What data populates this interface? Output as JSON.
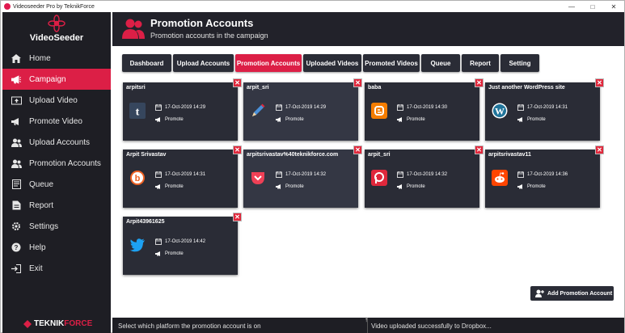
{
  "window": {
    "title": "Videoseeder Pro by TeknikForce",
    "minimize": "—",
    "maximize": "□",
    "close": "✕"
  },
  "sidebar": {
    "logo_text": "VideoSeeder",
    "items": [
      {
        "label": "Home",
        "icon": "home-icon"
      },
      {
        "label": "Campaign",
        "icon": "megaphone-icon"
      },
      {
        "label": "Upload Video",
        "icon": "upload-video-icon"
      },
      {
        "label": "Promote Video",
        "icon": "megaphone-icon"
      },
      {
        "label": "Upload Accounts",
        "icon": "users-icon"
      },
      {
        "label": "Promotion Accounts",
        "icon": "users-icon"
      },
      {
        "label": "Queue",
        "icon": "queue-icon"
      },
      {
        "label": "Report",
        "icon": "report-icon"
      },
      {
        "label": "Settings",
        "icon": "gear-icon"
      },
      {
        "label": "Help",
        "icon": "help-icon"
      },
      {
        "label": "Exit",
        "icon": "exit-icon"
      }
    ],
    "active_index": 1,
    "brand_part1": "TEKNIK",
    "brand_part2": "FORCE"
  },
  "header": {
    "title": "Promotion Accounts",
    "subtitle": "Promotion accounts in the campaign"
  },
  "tabs": [
    {
      "label": "Dashboard"
    },
    {
      "label": "Upload Accounts"
    },
    {
      "label": "Promotion Accounts"
    },
    {
      "label": "Uploaded Videos"
    },
    {
      "label": "Promoted Videos"
    },
    {
      "label": "Queue"
    },
    {
      "label": "Report"
    },
    {
      "label": "Setting"
    }
  ],
  "active_tab": 2,
  "cards": [
    {
      "name": "arpitsri",
      "platform": "tumblr-icon",
      "date": "17-Oct-2019 14:29",
      "status": "Promote"
    },
    {
      "name": "arpit_sri",
      "platform": "pen-icon",
      "date": "17-Oct-2019 14:29",
      "status": "Promote"
    },
    {
      "name": "baba",
      "platform": "blogger-icon",
      "date": "17-Oct-2019 14:30",
      "status": "Promote"
    },
    {
      "name": "Just another WordPress site",
      "platform": "wordpress-icon",
      "date": "17-Oct-2019 14:31",
      "status": "Promote"
    },
    {
      "name": "Arpit Srivastav",
      "platform": "bitly-icon",
      "date": "17-Oct-2019 14:31",
      "status": "Promote"
    },
    {
      "name": "arpitsrivastav%40teknikforce.com",
      "platform": "pocket-icon",
      "date": "17-Oct-2019 14:32",
      "status": "Promote"
    },
    {
      "name": "arpit_sri",
      "platform": "plurk-icon",
      "date": "17-Oct-2019 14:32",
      "status": "Promote"
    },
    {
      "name": "arpitsrivastav11",
      "platform": "reddit-icon",
      "date": "17-Oct-2019 14:36",
      "status": "Promote"
    },
    {
      "name": "Arpit43961625",
      "platform": "twitter-icon",
      "date": "17-Oct-2019 14:42",
      "status": "Promote"
    }
  ],
  "close_glyph": "✕",
  "add_button": {
    "label": "Add Promotion Account"
  },
  "status": {
    "left": "Select which platform the promotion account is on",
    "right": "Video uploaded successfully to Dropbox...",
    "arrow": "↑"
  },
  "colors": {
    "accent": "#dc1f46",
    "sidebar_bg": "#1e1e24",
    "card_bg": "#2a2c36"
  }
}
